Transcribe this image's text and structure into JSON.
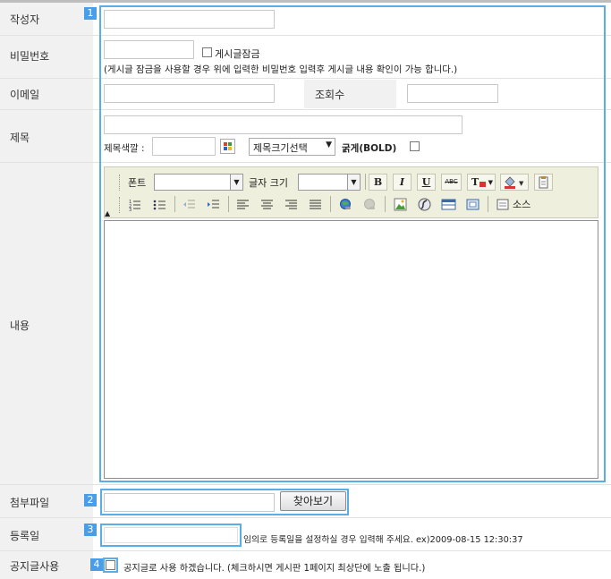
{
  "labels": {
    "author": "작성자",
    "password": "비밀번호",
    "email": "이메일",
    "views": "조회수",
    "subject": "제목",
    "content": "내용",
    "attachment": "첨부파일",
    "date": "등록일",
    "notice": "공지글사용"
  },
  "badges": [
    "1",
    "2",
    "3",
    "4"
  ],
  "password_row": {
    "lock_label": "게시글잠금",
    "hint": "(게시글 잠금을 사용할 경우 위에 입력한 비밀번호 입력후 게시글 내용 확인이 가능 합니다.)"
  },
  "subject_row": {
    "color_label": "제목색깔 :",
    "size_select": "제목크기선택",
    "bold_label": "굵게(BOLD)"
  },
  "toolbar": {
    "font_label": "폰트",
    "size_label": "글자 크기",
    "bold": "B",
    "italic": "I",
    "underline": "U",
    "strike": "ABC",
    "text_color": "T",
    "source": "소스"
  },
  "attachment_row": {
    "browse": "찾아보기"
  },
  "date_row": {
    "hint": "임의로 등록일을 설정하실 경우 입력해 주세요. ex)2009-08-15 12:30:37"
  },
  "notice_row": {
    "text": "공지글로 사용 하겠습니다. (체크하시면 게시판 1페이지 최상단에 노출 됩니다.)"
  },
  "colors": {
    "highlight": "#5aaee8",
    "badge": "#4a9ee8",
    "label_bg": "#f1f1f1",
    "toolbar_bg": "#efefde"
  }
}
